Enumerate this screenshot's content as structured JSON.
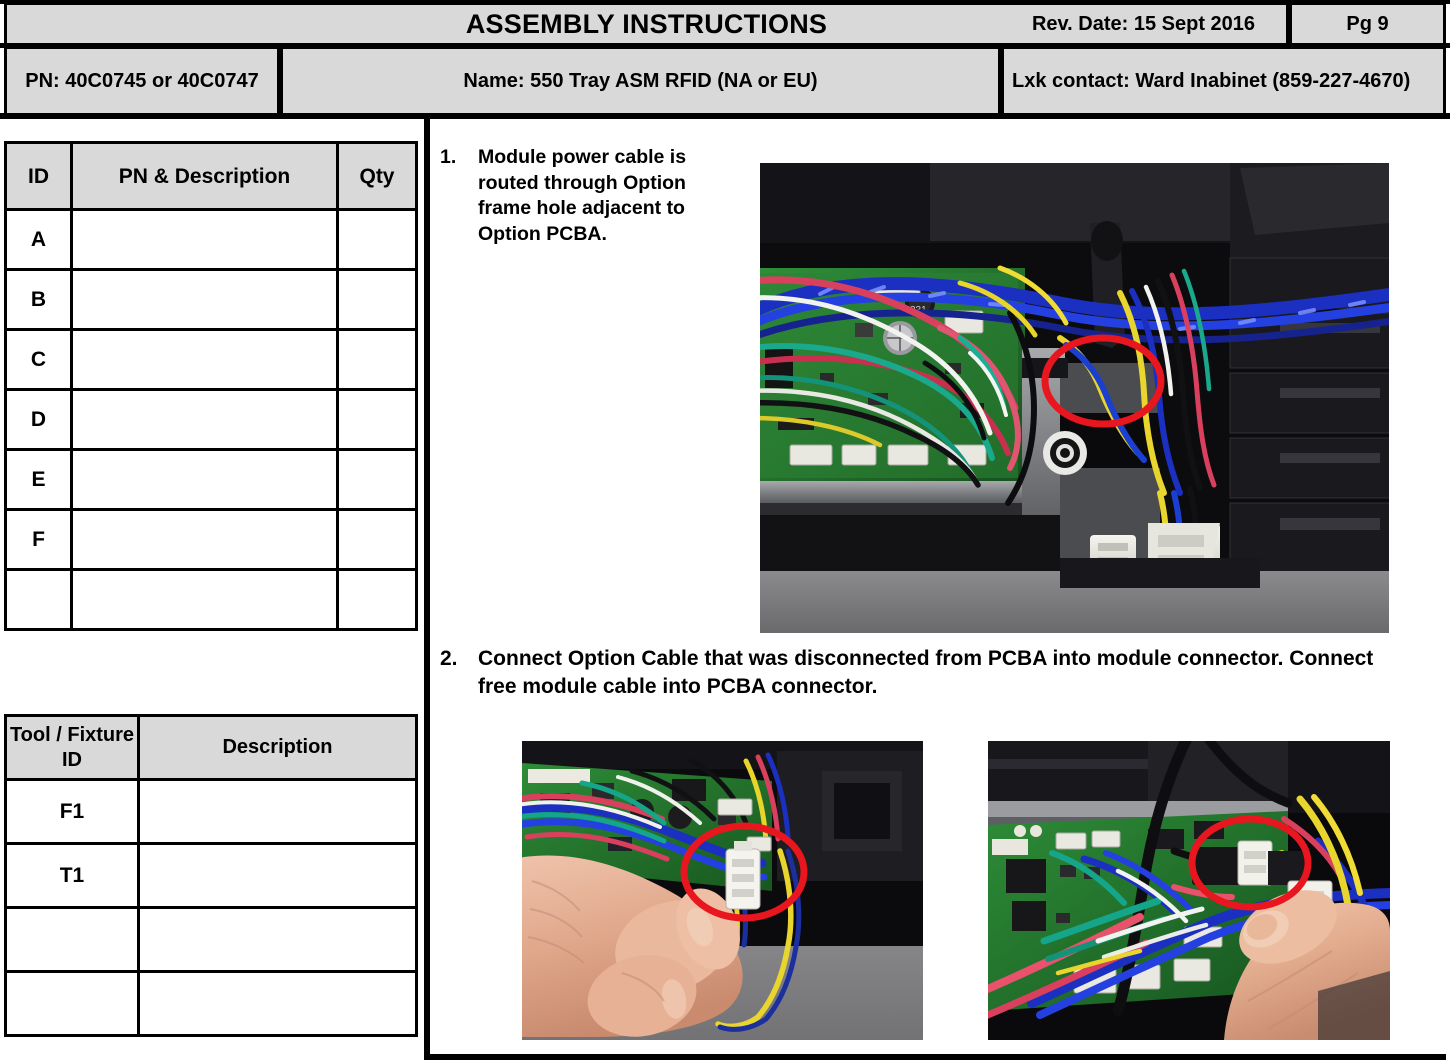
{
  "header": {
    "title": "ASSEMBLY INSTRUCTIONS",
    "rev_date": "Rev. Date: 15 Sept 2016",
    "page": "Pg  9",
    "pn": "PN:  40C0745 or 40C0747",
    "name": "Name:  550 Tray ASM RFID (NA or EU)",
    "contact": "Lxk contact: Ward Inabinet (859-227-4670)"
  },
  "parts_table": {
    "columns": [
      "ID",
      "PN & Description",
      "Qty"
    ],
    "rows": [
      {
        "id": "A",
        "description": "",
        "qty": ""
      },
      {
        "id": "B",
        "description": "",
        "qty": ""
      },
      {
        "id": "C",
        "description": "",
        "qty": ""
      },
      {
        "id": "D",
        "description": "",
        "qty": ""
      },
      {
        "id": "E",
        "description": "",
        "qty": ""
      },
      {
        "id": "F",
        "description": "",
        "qty": ""
      },
      {
        "id": "",
        "description": "",
        "qty": ""
      }
    ]
  },
  "tool_table": {
    "columns": [
      "Tool / Fixture ID",
      "Description"
    ],
    "rows": [
      {
        "id": "F1",
        "description": ""
      },
      {
        "id": "T1",
        "description": ""
      },
      {
        "id": "",
        "description": ""
      },
      {
        "id": "",
        "description": ""
      }
    ]
  },
  "steps": [
    {
      "number": "1.",
      "text": "Module power cable is routed through Option frame hole adjacent to Option PCBA."
    },
    {
      "number": "2.",
      "text": "Connect Option Cable that was disconnected from PCBA into module connector. Connect free module cable into PCBA connector."
    }
  ],
  "photos": [
    {
      "caption_ref": "step-1",
      "description": "Interior view of printer module showing green Option PCBA at left with multicolored wire harness routed through metal frame; red ellipse highlights the frame hole where the module power cable passes; two white connectors hang at lower right."
    },
    {
      "caption_ref": "step-2-left",
      "description": "Hand holding a white two-pin module connector with yellow and blue twisted wires; red ellipse highlights the connector; green PCBA with wire harness above."
    },
    {
      "caption_ref": "step-2-right",
      "description": "Finger pointing at mated connector on green PCBA surrounded by blue, yellow, red and white wires; red ellipse highlights the PCBA connector."
    }
  ],
  "colors": {
    "annotation_red": "#e8161e",
    "header_fill": "#d9d9d9",
    "border": "#000000"
  }
}
